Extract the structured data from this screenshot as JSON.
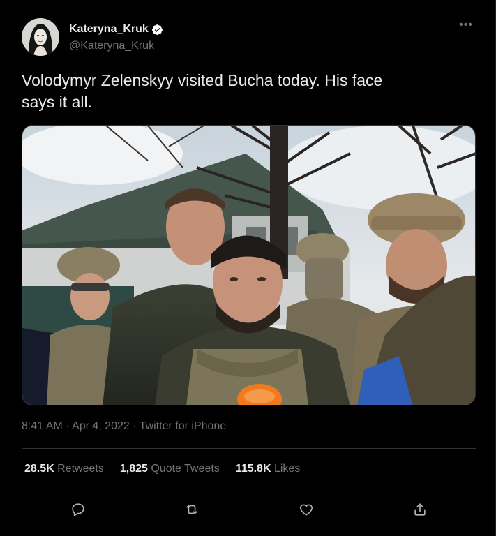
{
  "author": {
    "display_name": "Kateryna_Kruk",
    "handle": "@Kateryna_Kruk",
    "verified": true
  },
  "tweet": {
    "text": "Volodymyr Zelenskyy visited Bucha today. His face\nsays it all."
  },
  "meta": {
    "time": "8:41 AM",
    "separator": " · ",
    "date": "Apr 4, 2022",
    "source": "Twitter for iPhone"
  },
  "stats": [
    {
      "value": "28.5K",
      "label": "Retweets"
    },
    {
      "value": "1,825",
      "label": "Quote Tweets"
    },
    {
      "value": "115.8K",
      "label": "Likes"
    }
  ],
  "actions": [
    "reply-icon",
    "retweet-icon",
    "like-icon",
    "share-icon"
  ],
  "colors": {
    "background": "#000000",
    "text": "#e7e9ea",
    "secondary_text": "#71767b",
    "divider": "#2f3336",
    "verified_badge": "#ffffff"
  }
}
